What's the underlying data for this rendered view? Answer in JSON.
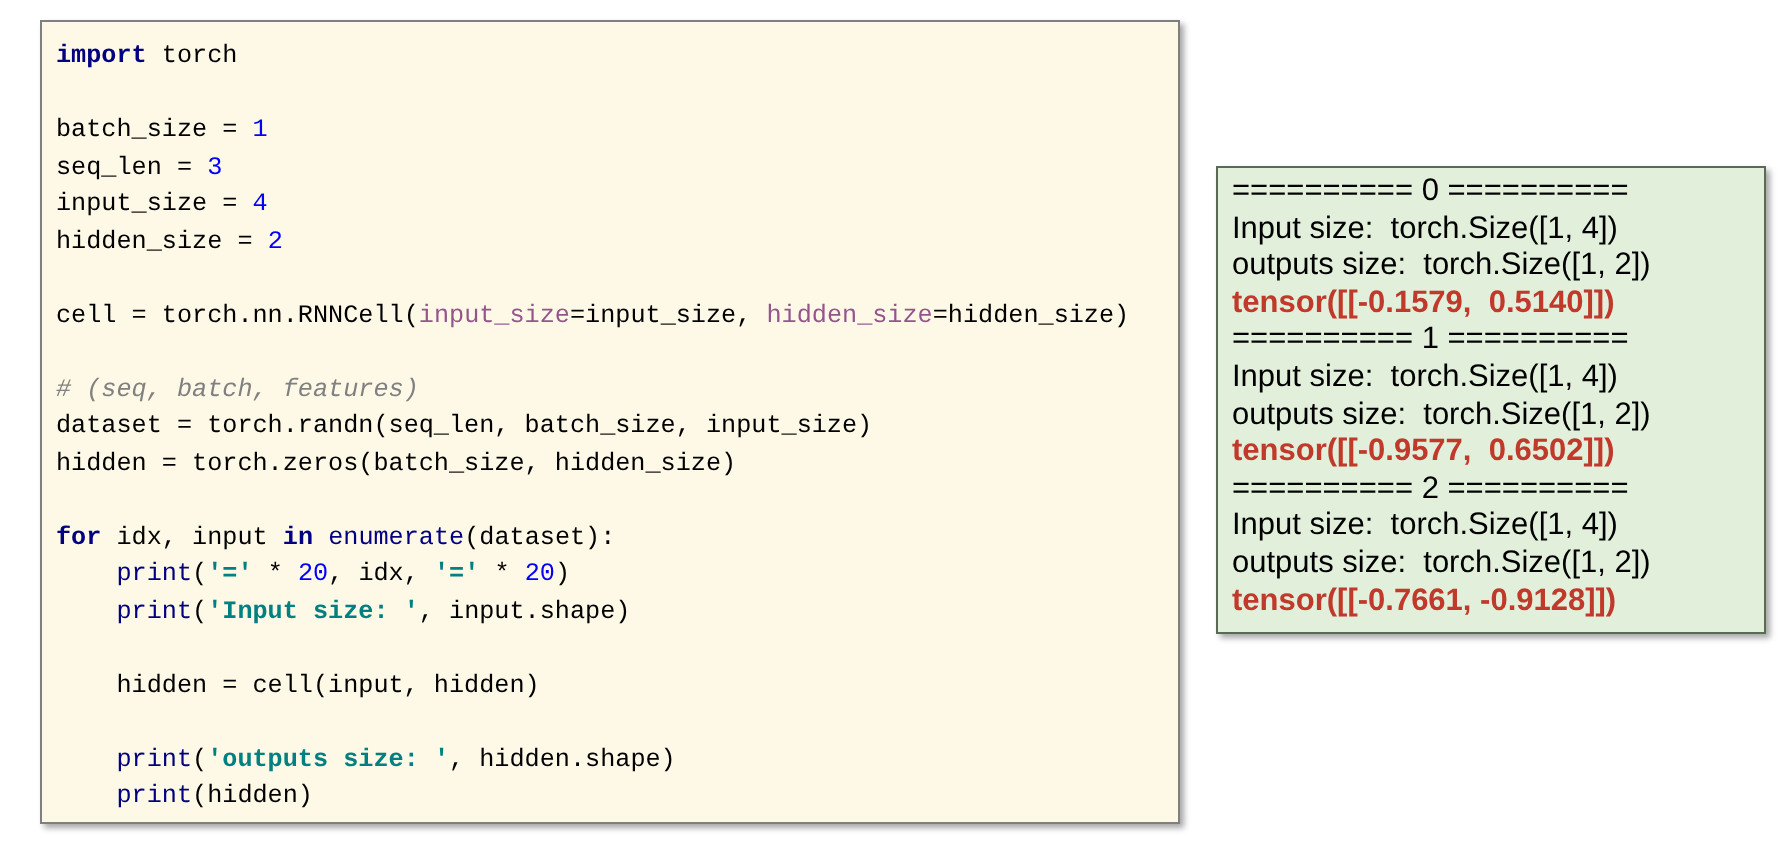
{
  "code": {
    "blocks": [
      [
        {
          "tokens": [
            {
              "kind": "keyword",
              "text": "import"
            },
            {
              "kind": "plain",
              "text": " torch"
            }
          ]
        }
      ],
      [
        {
          "tokens": [
            {
              "kind": "plain",
              "text": "batch_size = "
            },
            {
              "kind": "number",
              "text": "1"
            }
          ]
        },
        {
          "tokens": [
            {
              "kind": "plain",
              "text": "seq_len = "
            },
            {
              "kind": "number",
              "text": "3"
            }
          ]
        },
        {
          "tokens": [
            {
              "kind": "plain",
              "text": "input_size = "
            },
            {
              "kind": "number",
              "text": "4"
            }
          ]
        },
        {
          "tokens": [
            {
              "kind": "plain",
              "text": "hidden_size = "
            },
            {
              "kind": "number",
              "text": "2"
            }
          ]
        }
      ],
      [
        {
          "tokens": [
            {
              "kind": "plain",
              "text": "cell = torch.nn.RNNCell("
            },
            {
              "kind": "param",
              "text": "input_size"
            },
            {
              "kind": "plain",
              "text": "=input_size, "
            },
            {
              "kind": "param",
              "text": "hidden_size"
            },
            {
              "kind": "plain",
              "text": "=hidden_size)"
            }
          ]
        }
      ],
      [
        {
          "tokens": [
            {
              "kind": "comment",
              "text": "# (seq, batch, features)"
            }
          ]
        },
        {
          "tokens": [
            {
              "kind": "plain",
              "text": "dataset = torch.randn(seq_len, batch_size, input_size)"
            }
          ]
        },
        {
          "tokens": [
            {
              "kind": "plain",
              "text": "hidden = torch.zeros(batch_size, hidden_size)"
            }
          ]
        }
      ],
      [
        {
          "tokens": [
            {
              "kind": "keyword",
              "text": "for"
            },
            {
              "kind": "plain",
              "text": " idx, input "
            },
            {
              "kind": "keyword",
              "text": "in"
            },
            {
              "kind": "builtin",
              "text": " enumerate"
            },
            {
              "kind": "plain",
              "text": "(dataset):"
            }
          ]
        },
        {
          "indent": true,
          "tokens": [
            {
              "kind": "builtin",
              "text": "print"
            },
            {
              "kind": "plain",
              "text": "("
            },
            {
              "kind": "string",
              "text": "'='"
            },
            {
              "kind": "plain",
              "text": " * "
            },
            {
              "kind": "number",
              "text": "20"
            },
            {
              "kind": "plain",
              "text": ", idx, "
            },
            {
              "kind": "string",
              "text": "'='"
            },
            {
              "kind": "plain",
              "text": " * "
            },
            {
              "kind": "number",
              "text": "20"
            },
            {
              "kind": "plain",
              "text": ")"
            }
          ]
        },
        {
          "indent": true,
          "tokens": [
            {
              "kind": "builtin",
              "text": "print"
            },
            {
              "kind": "plain",
              "text": "("
            },
            {
              "kind": "string",
              "text": "'Input size: '"
            },
            {
              "kind": "plain",
              "text": ", input.shape)"
            }
          ]
        }
      ],
      [
        {
          "indent": true,
          "tokens": [
            {
              "kind": "plain",
              "text": "hidden = cell(input, hidden)"
            }
          ]
        }
      ],
      [
        {
          "indent": true,
          "tokens": [
            {
              "kind": "builtin",
              "text": "print"
            },
            {
              "kind": "plain",
              "text": "("
            },
            {
              "kind": "string",
              "text": "'outputs size: '"
            },
            {
              "kind": "plain",
              "text": ", hidden.shape)"
            }
          ]
        },
        {
          "indent": true,
          "tokens": [
            {
              "kind": "builtin",
              "text": "print"
            },
            {
              "kind": "plain",
              "text": "(hidden)"
            }
          ]
        }
      ]
    ]
  },
  "output": {
    "lines": [
      {
        "kind": "separator",
        "text": "========== 0 =========="
      },
      {
        "kind": "info",
        "text": "Input size:  torch.Size([1, 4])"
      },
      {
        "kind": "info",
        "text": "outputs size:  torch.Size([1, 2])"
      },
      {
        "kind": "tensor",
        "text": "tensor([[-0.1579,  0.5140]])"
      },
      {
        "kind": "separator",
        "text": "========== 1 =========="
      },
      {
        "kind": "info",
        "text": "Input size:  torch.Size([1, 4])"
      },
      {
        "kind": "info",
        "text": "outputs size:  torch.Size([1, 2])"
      },
      {
        "kind": "tensor",
        "text": "tensor([[-0.9577,  0.6502]])"
      },
      {
        "kind": "separator",
        "text": "========== 2 =========="
      },
      {
        "kind": "info",
        "text": "Input size:  torch.Size([1, 4])"
      },
      {
        "kind": "info",
        "text": "outputs size:  torch.Size([1, 2])"
      },
      {
        "kind": "tensor",
        "text": "tensor([[-0.7661, -0.9128]])"
      }
    ]
  }
}
